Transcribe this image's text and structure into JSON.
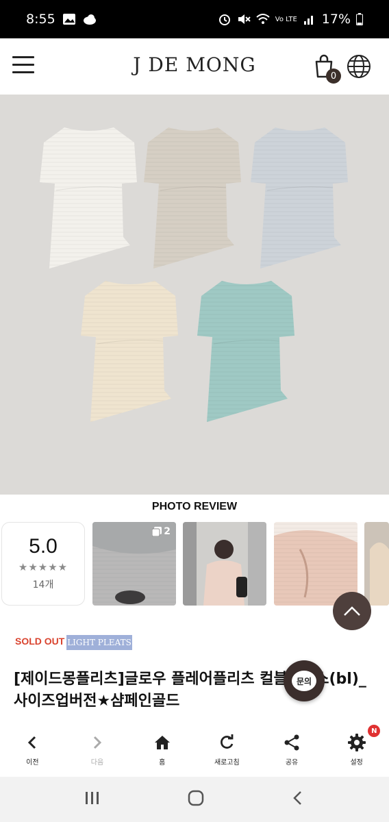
{
  "status_bar": {
    "time": "8:55",
    "battery": "17%",
    "network": "Vo LTE"
  },
  "header": {
    "logo": "J DE MONG",
    "cart_count": "0"
  },
  "hero": {
    "colors": [
      "#f3f1ec",
      "#d6cfc4",
      "#cdd3d9",
      "#efe4cf",
      "#9fc9c4"
    ]
  },
  "photo_review": {
    "title": "PHOTO REVIEW",
    "rating": "5.0",
    "stars": "★★★★★",
    "count": "14개",
    "thumb_badge": "2"
  },
  "product": {
    "badge_soldout": "SOLD OUT",
    "badge_pleats": "LIGHT PLEATS",
    "title": "[제이드몽플리츠]글로우 플레어플리츠 컬블라우스(bl)_사이즈업버전★샴페인골드"
  },
  "inquiry": {
    "label": "문의"
  },
  "bottom_nav": {
    "items": [
      {
        "label": "이전",
        "icon": "chevron-left-icon"
      },
      {
        "label": "다음",
        "icon": "chevron-right-icon"
      },
      {
        "label": "홈",
        "icon": "home-icon"
      },
      {
        "label": "새로고침",
        "icon": "refresh-icon"
      },
      {
        "label": "공유",
        "icon": "share-icon"
      },
      {
        "label": "설정",
        "icon": "gear-icon"
      }
    ],
    "settings_badge": "N"
  }
}
